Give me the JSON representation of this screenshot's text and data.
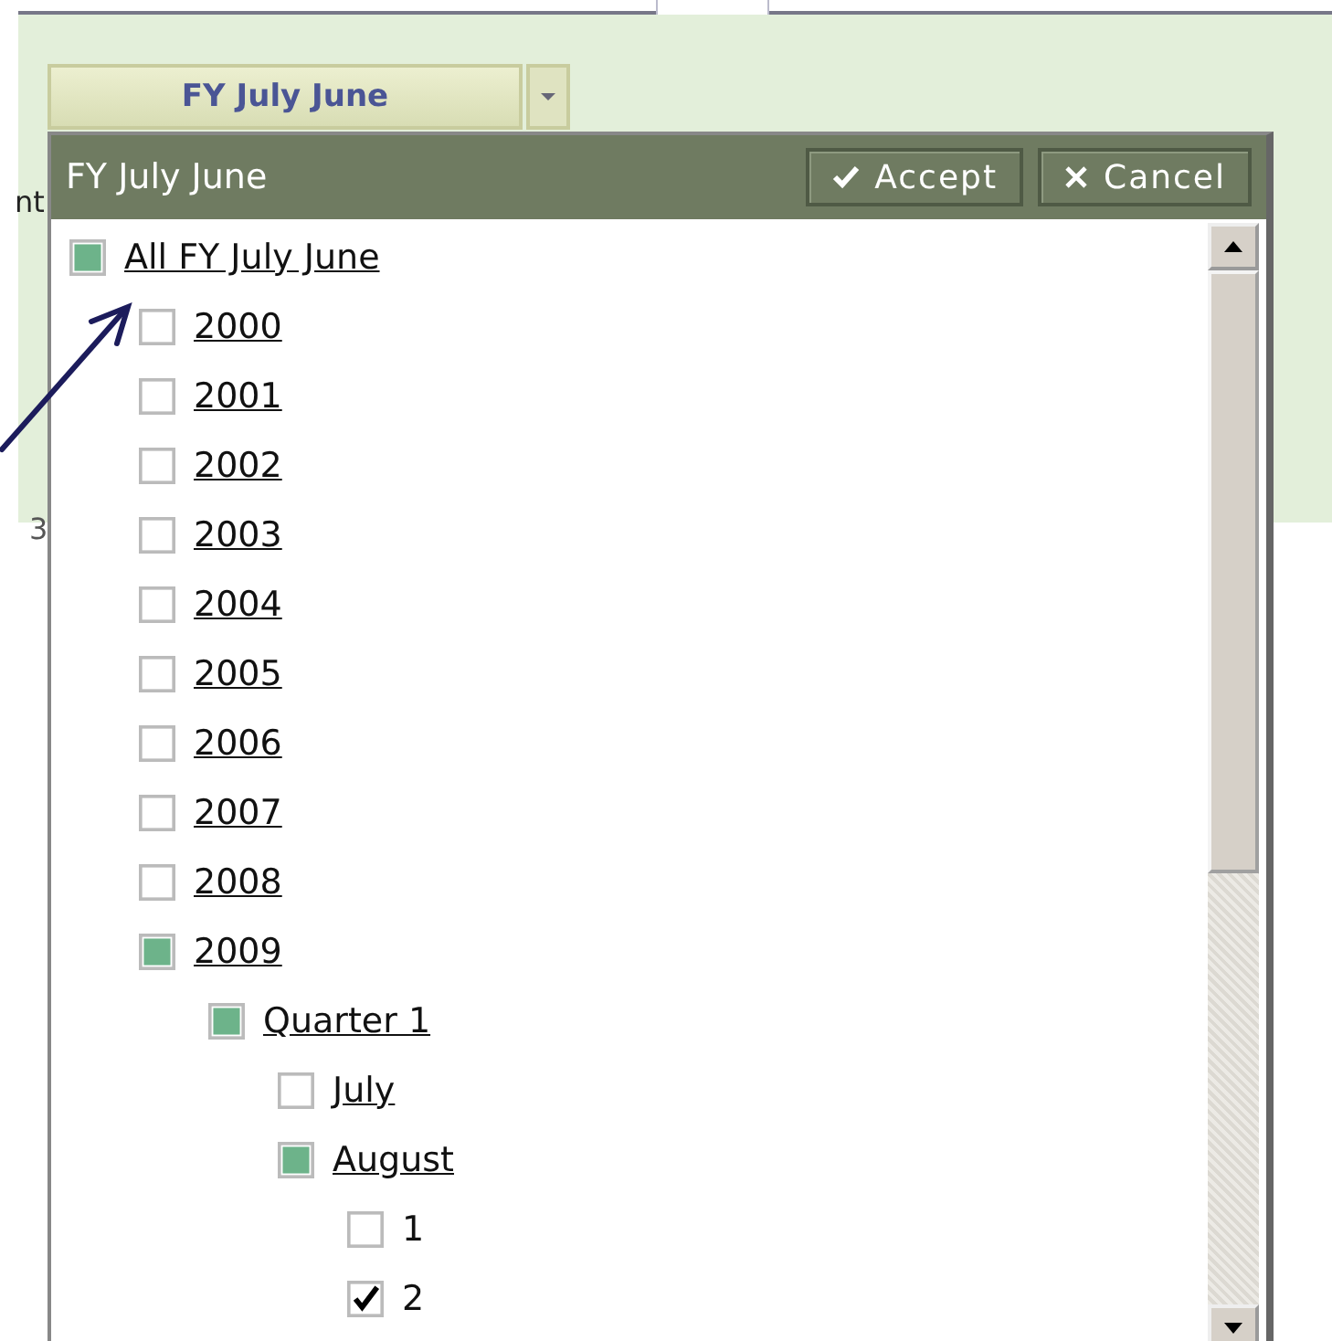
{
  "page": {
    "fragments": [
      "nt",
      "3"
    ]
  },
  "dropdown": {
    "value": "FY July June"
  },
  "popup": {
    "title": "FY July June",
    "buttons": [
      {
        "label": "Accept",
        "kind": "accept"
      },
      {
        "label": "Cancel",
        "kind": "cancel"
      }
    ],
    "tree": [
      {
        "label": "All FY July June",
        "kind": "group",
        "checked": false,
        "partial": true,
        "children": [
          {
            "label": "2000",
            "kind": "group",
            "checked": false,
            "partial": false
          },
          {
            "label": "2001",
            "kind": "group",
            "checked": false,
            "partial": false
          },
          {
            "label": "2002",
            "kind": "group",
            "checked": false,
            "partial": false
          },
          {
            "label": "2003",
            "kind": "group",
            "checked": false,
            "partial": false
          },
          {
            "label": "2004",
            "kind": "group",
            "checked": false,
            "partial": false
          },
          {
            "label": "2005",
            "kind": "group",
            "checked": false,
            "partial": false
          },
          {
            "label": "2006",
            "kind": "group",
            "checked": false,
            "partial": false
          },
          {
            "label": "2007",
            "kind": "group",
            "checked": false,
            "partial": false
          },
          {
            "label": "2008",
            "kind": "group",
            "checked": false,
            "partial": false
          },
          {
            "label": "2009",
            "kind": "group",
            "checked": false,
            "partial": true,
            "children": [
              {
                "label": "Quarter 1",
                "kind": "group",
                "checked": false,
                "partial": true,
                "children": [
                  {
                    "label": "July",
                    "kind": "group",
                    "checked": false,
                    "partial": false
                  },
                  {
                    "label": "August",
                    "kind": "group",
                    "checked": false,
                    "partial": true,
                    "children": [
                      {
                        "label": "1",
                        "kind": "leaf",
                        "checked": false,
                        "partial": false
                      },
                      {
                        "label": "2",
                        "kind": "leaf",
                        "checked": true,
                        "partial": false
                      }
                    ]
                  }
                ]
              }
            ]
          }
        ]
      }
    ]
  }
}
